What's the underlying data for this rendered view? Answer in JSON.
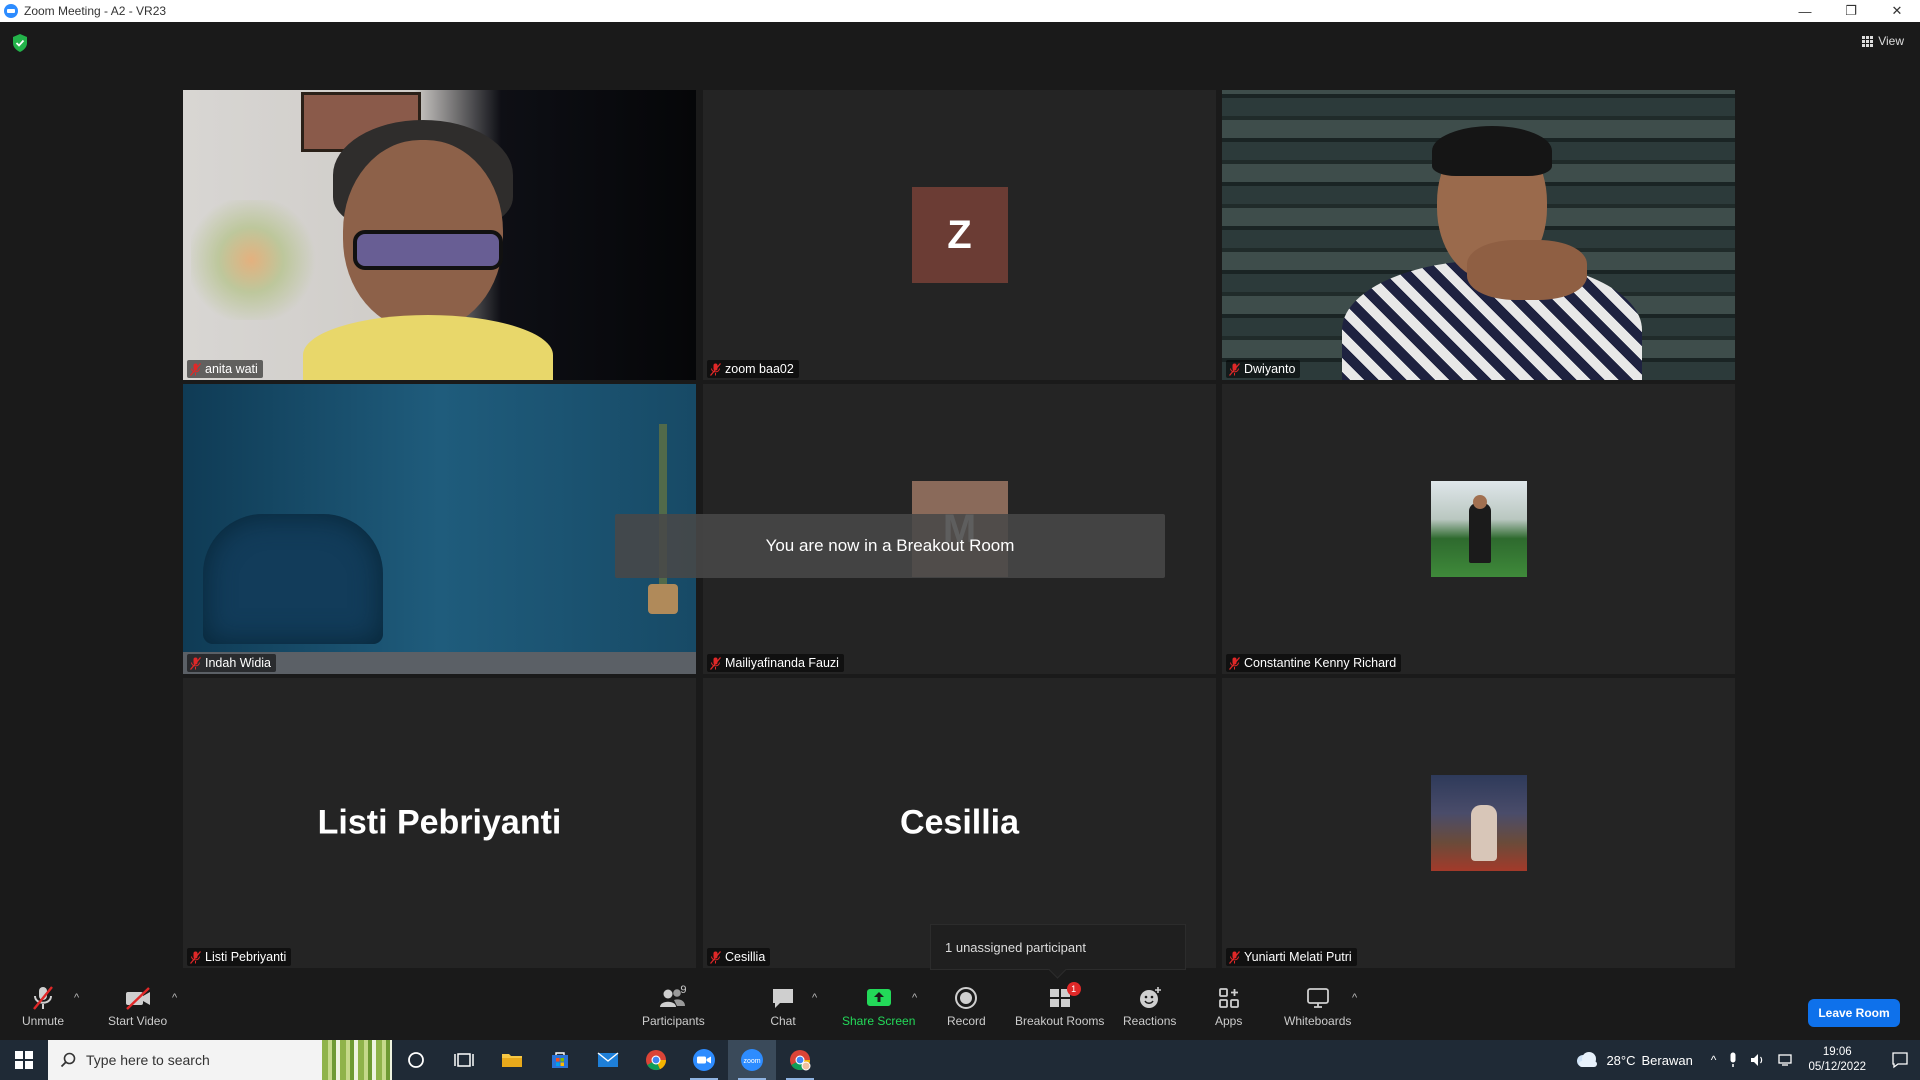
{
  "window": {
    "title": "Zoom Meeting - A2 - VR23",
    "controls": [
      "—",
      "❐",
      "✕"
    ]
  },
  "stage": {
    "view_label": "View",
    "breakout_toast": "You are now in a Breakout Room",
    "unassigned_popup": "1 unassigned participant"
  },
  "tiles": [
    {
      "name": "anita wati",
      "kind": "video",
      "active": true,
      "muted": true
    },
    {
      "name": "zoom baa02",
      "kind": "initial",
      "initial": "Z",
      "initial_bg": "#6b3c34",
      "muted": true
    },
    {
      "name": "Dwiyanto",
      "kind": "video",
      "muted": true
    },
    {
      "name": "Indah Widia",
      "kind": "video",
      "muted": true
    },
    {
      "name": "Mailiyafinanda Fauzi",
      "kind": "initial",
      "initial": "M",
      "initial_bg": "#8a6a5a",
      "muted": true
    },
    {
      "name": "Constantine Kenny Richard",
      "kind": "photo",
      "muted": true
    },
    {
      "name": "Listi Pebriyanti",
      "kind": "bigname",
      "big_label": "Listi Pebriyanti",
      "muted": true
    },
    {
      "name": "Cesillia",
      "kind": "bigname",
      "big_label": "Cesillia",
      "muted": true
    },
    {
      "name": "Yuniarti Melati Putri",
      "kind": "photo",
      "muted": true
    }
  ],
  "toolbar": {
    "unmute": "Unmute",
    "start_video": "Start Video",
    "participants": "Participants",
    "participants_count": "9",
    "chat": "Chat",
    "share_screen": "Share Screen",
    "record": "Record",
    "breakout_rooms": "Breakout Rooms",
    "breakout_badge": "1",
    "reactions": "Reactions",
    "apps": "Apps",
    "whiteboards": "Whiteboards",
    "leave": "Leave Room",
    "share_color": "#23d959",
    "leave_color": "#0e71eb"
  },
  "taskbar": {
    "search_placeholder": "Type here to search",
    "apps": [
      "cortana-icon",
      "task-view-icon",
      "file-explorer-icon",
      "store-icon",
      "mail-icon",
      "chrome-icon",
      "zoom-icon",
      "zoom-meeting-icon",
      "chrome-profile-icon"
    ],
    "weather_temp": "28°C",
    "weather_text": "Berawan",
    "time": "19:06",
    "date": "05/12/2022"
  }
}
